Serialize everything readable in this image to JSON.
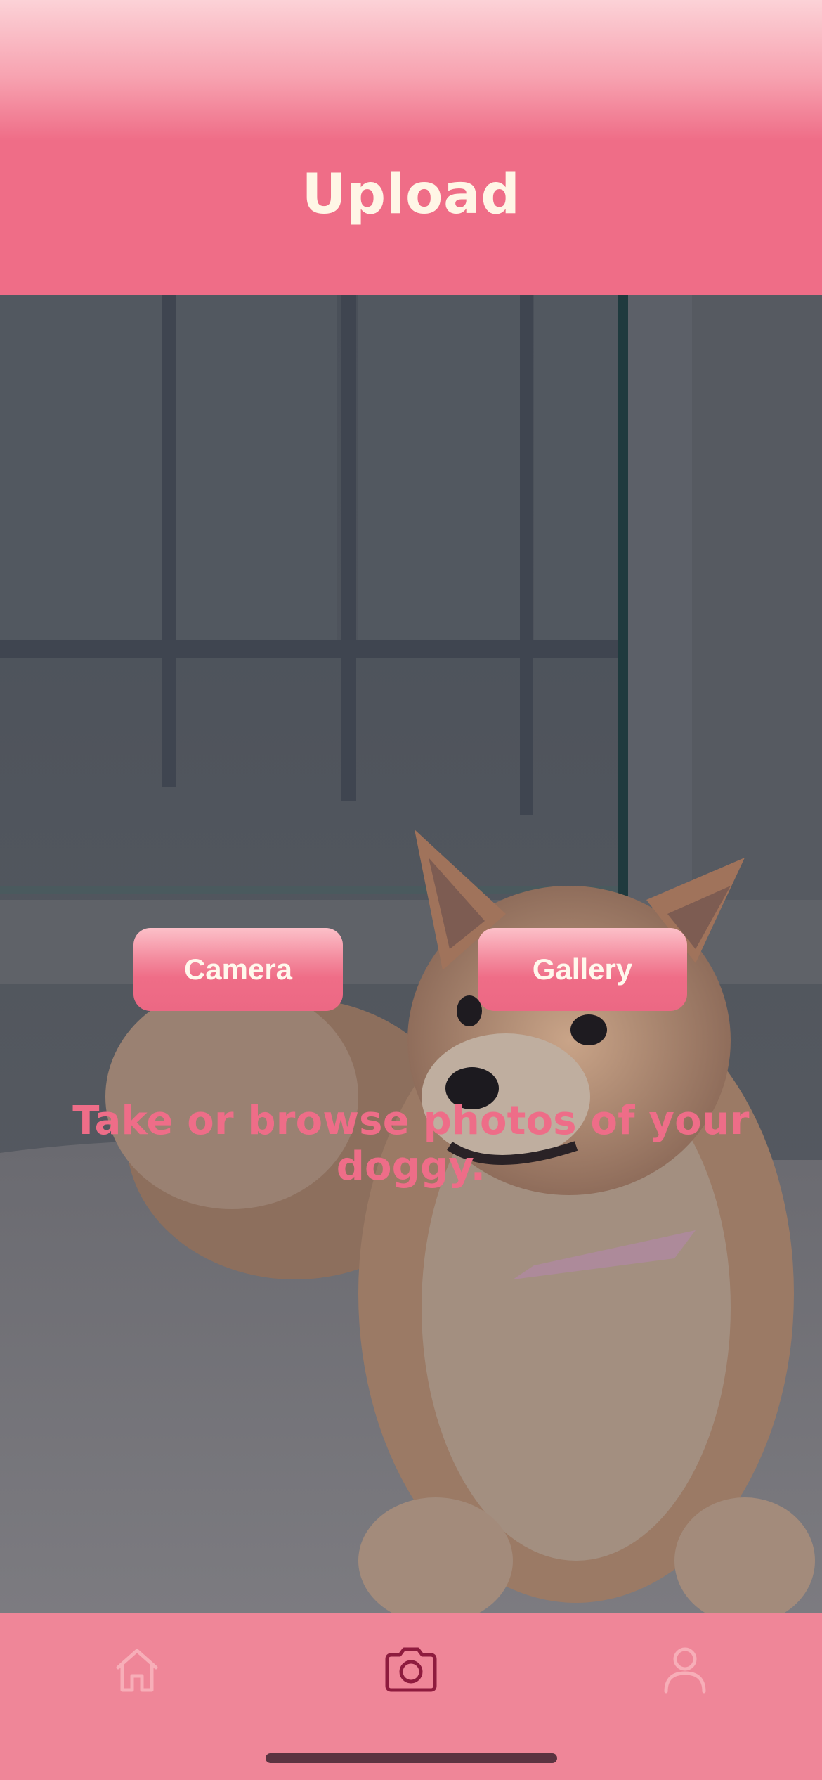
{
  "header": {
    "title": "Upload"
  },
  "main": {
    "camera_button_label": "Camera",
    "gallery_button_label": "Gallery",
    "prompt": "Take or browse photos of your doggy."
  },
  "background_photo": {
    "subject": "dog-photo"
  },
  "tabbar": {
    "items": [
      {
        "icon": "home-icon",
        "active": false
      },
      {
        "icon": "camera-icon",
        "active": true
      },
      {
        "icon": "profile-icon",
        "active": false
      }
    ]
  },
  "colors": {
    "accent": "#ef6d87",
    "header_text": "#fff6e6",
    "tabbar_bg": "#ef8698",
    "active_icon": "#8e1b3e",
    "inactive_icon": "#f7aeb8"
  }
}
